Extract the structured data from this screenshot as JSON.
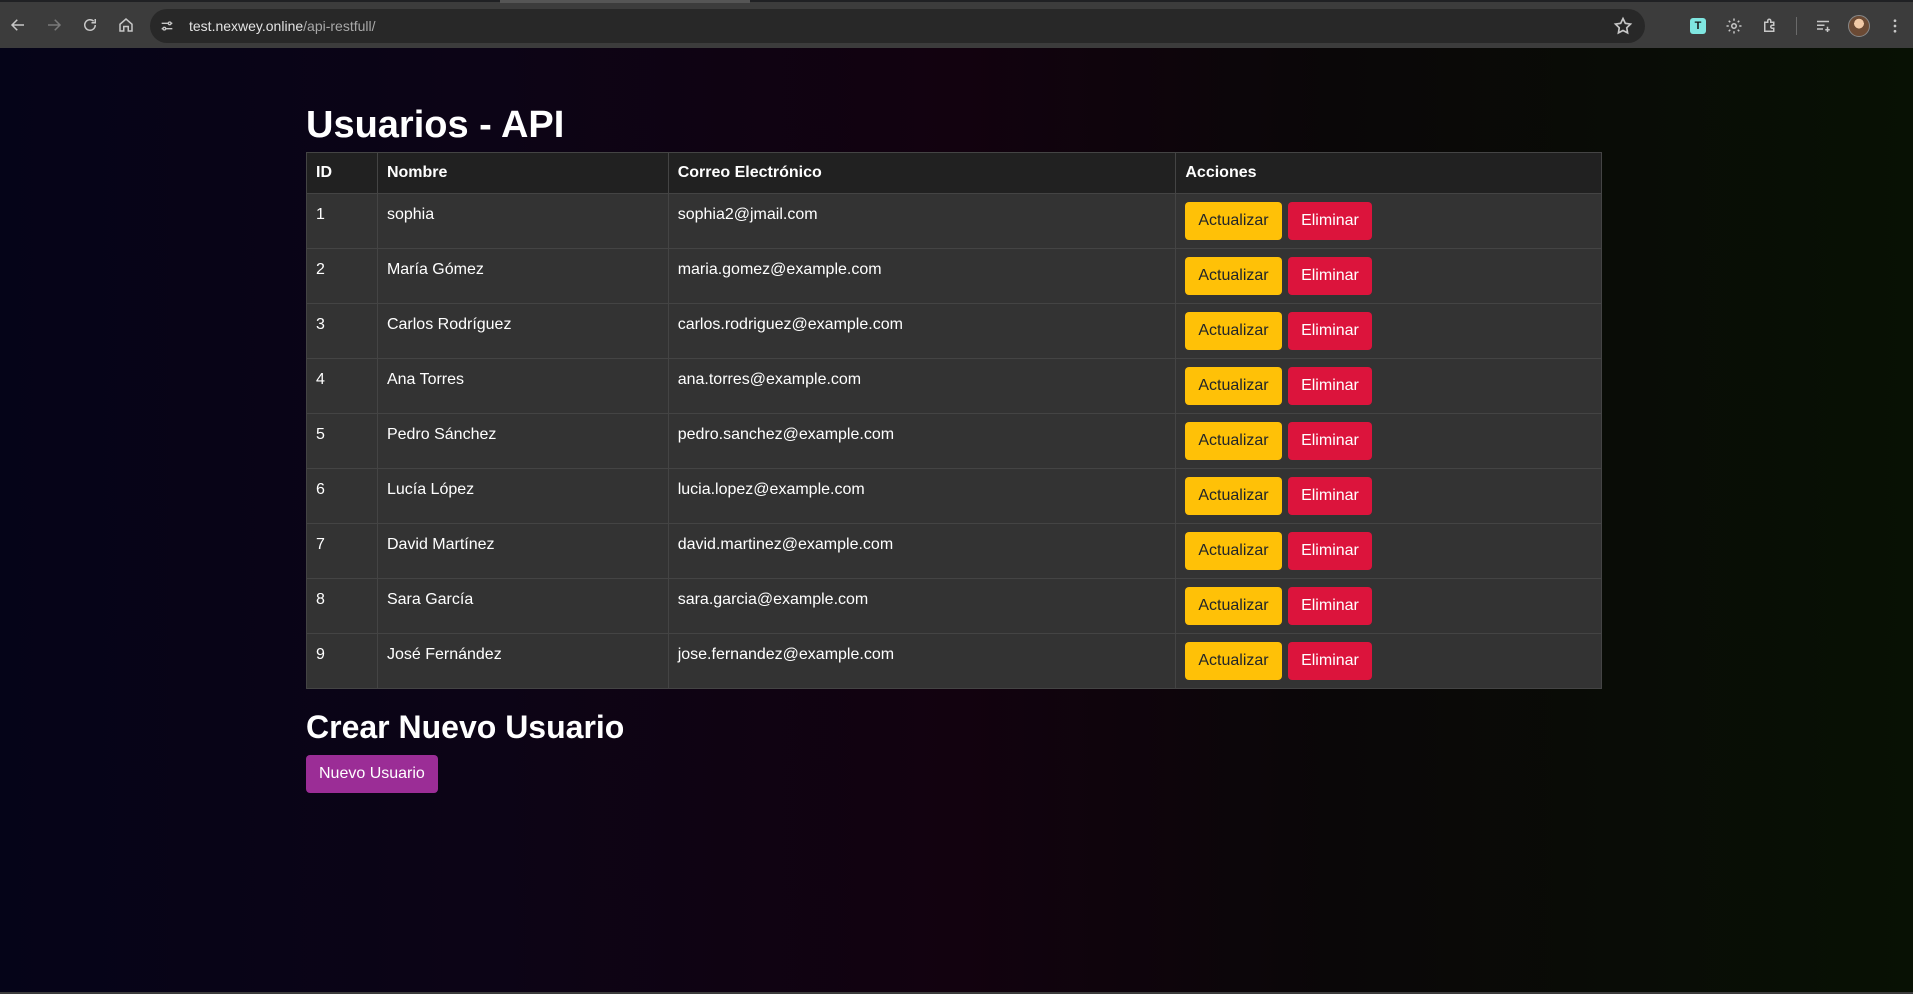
{
  "browser": {
    "url_host": "test.nexwey.online",
    "url_path": "/api-restfull/",
    "extension_label": "T"
  },
  "page": {
    "title": "Usuarios - API",
    "table": {
      "headers": [
        "ID",
        "Nombre",
        "Correo Electrónico",
        "Acciones"
      ],
      "rows": [
        {
          "id": "1",
          "name": "sophia",
          "email": "sophia2@jmail.com"
        },
        {
          "id": "2",
          "name": "María Gómez",
          "email": "maria.gomez@example.com"
        },
        {
          "id": "3",
          "name": "Carlos Rodríguez",
          "email": "carlos.rodriguez@example.com"
        },
        {
          "id": "4",
          "name": "Ana Torres",
          "email": "ana.torres@example.com"
        },
        {
          "id": "5",
          "name": "Pedro Sánchez",
          "email": "pedro.sanchez@example.com"
        },
        {
          "id": "6",
          "name": "Lucía López",
          "email": "lucia.lopez@example.com"
        },
        {
          "id": "7",
          "name": "David Martínez",
          "email": "david.martinez@example.com"
        },
        {
          "id": "8",
          "name": "Sara García",
          "email": "sara.garcia@example.com"
        },
        {
          "id": "9",
          "name": "José Fernández",
          "email": "jose.fernandez@example.com"
        }
      ],
      "update_label": "Actualizar",
      "delete_label": "Eliminar"
    },
    "create_heading": "Crear Nuevo Usuario",
    "new_user_label": "Nuevo Usuario"
  },
  "colors": {
    "update_button": "#ffc107",
    "delete_button": "#dc143c",
    "new_user_button": "#9b2d96",
    "table_bg": "#333333",
    "table_header_bg": "#212121"
  }
}
